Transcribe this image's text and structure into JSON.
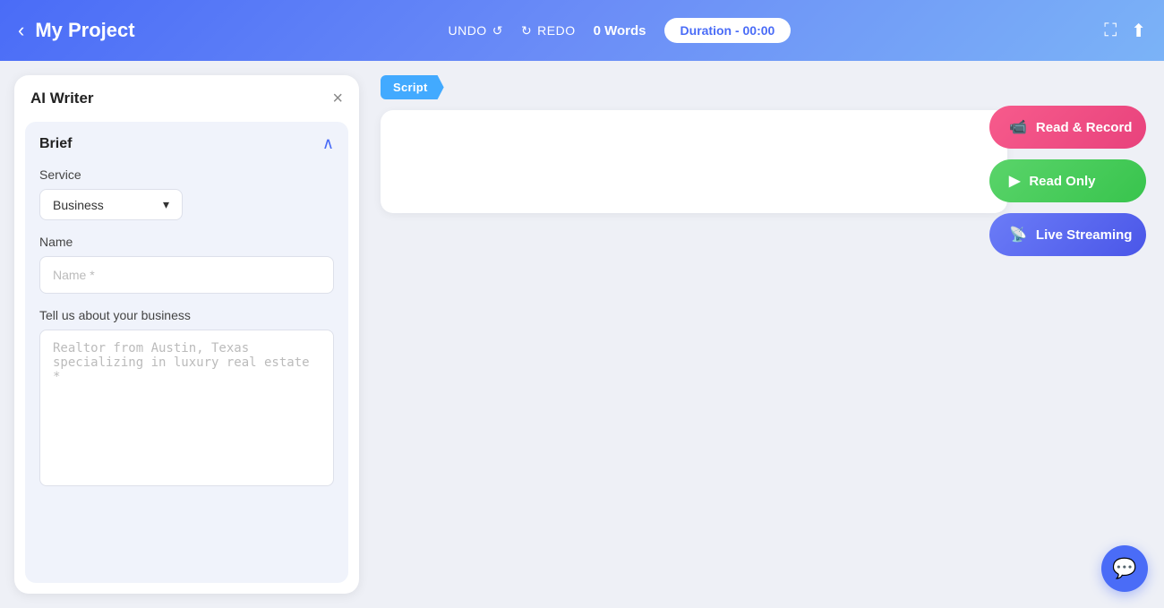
{
  "header": {
    "back_icon": "‹",
    "title": "My Project",
    "undo_label": "UNDO",
    "undo_icon": "↺",
    "redo_label": "REDO",
    "redo_icon": "↻",
    "words_label": "0 Words",
    "duration_label": "Duration - 00:00",
    "fullscreen_icon": "⛶",
    "share_icon": "⬆"
  },
  "ai_writer": {
    "title": "AI Writer",
    "close_icon": "×",
    "brief": {
      "title": "Brief",
      "chevron_icon": "∧",
      "service": {
        "label": "Service",
        "value": "Business",
        "dropdown_icon": "▾"
      },
      "name": {
        "label": "Name",
        "placeholder": "Name *"
      },
      "business_description": {
        "label": "Tell us about your business",
        "placeholder": "Realtor from Austin, Texas specializing in luxury real estate *"
      }
    }
  },
  "script": {
    "tag_label": "Script"
  },
  "actions": {
    "read_record": {
      "label": "Read & Record",
      "icon": "🔴"
    },
    "read_only": {
      "label": "Read Only",
      "icon": "▶"
    },
    "live_streaming": {
      "label": "Live Streaming",
      "icon": "📡"
    }
  },
  "chat": {
    "icon": "💬"
  }
}
